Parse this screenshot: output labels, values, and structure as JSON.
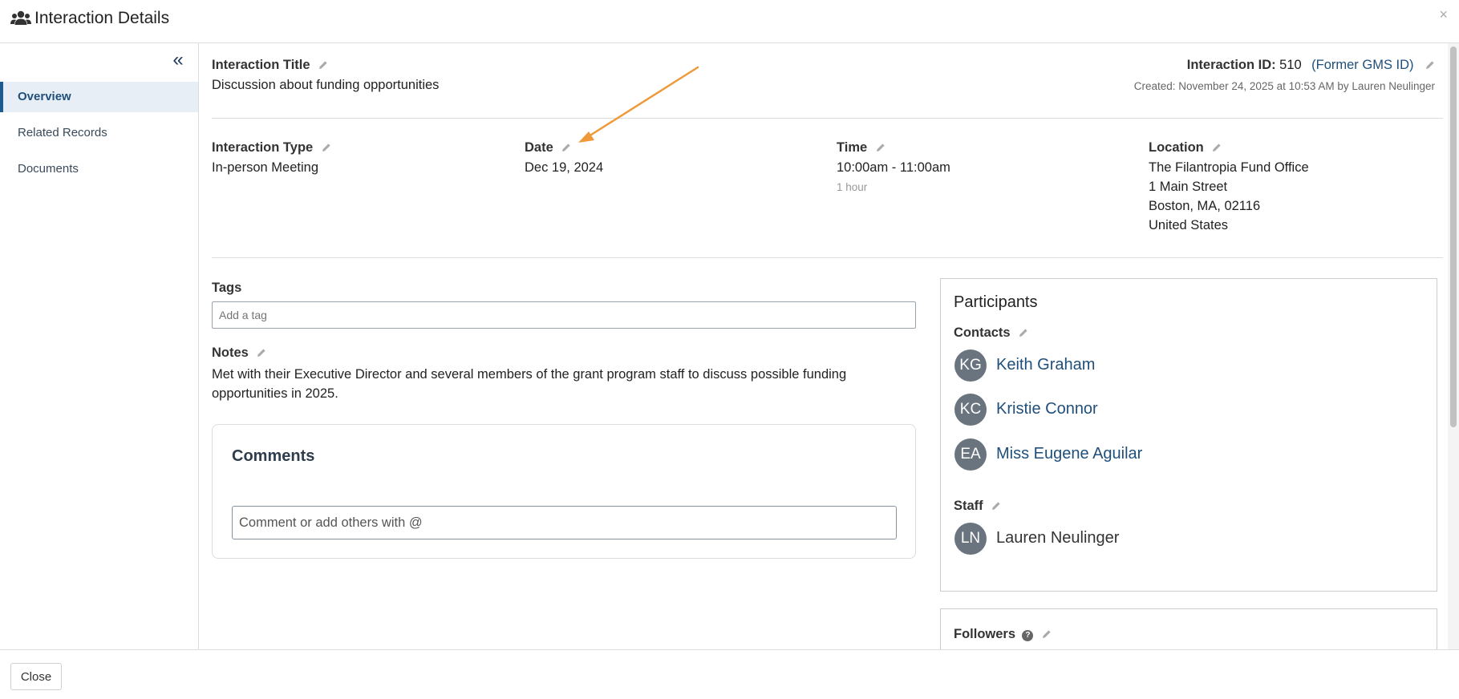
{
  "header": {
    "title": "Interaction Details",
    "icon": "users-icon",
    "close_glyph": "×"
  },
  "sidebar": {
    "collapse_glyph": "«",
    "items": [
      {
        "label": "Overview",
        "active": true
      },
      {
        "label": "Related Records",
        "active": false
      },
      {
        "label": "Documents",
        "active": false
      }
    ]
  },
  "overview": {
    "title_label": "Interaction Title",
    "title_value": "Discussion about funding opportunities",
    "id_label": "Interaction ID:",
    "id_value": "510",
    "former_id_link": "(Former GMS ID)",
    "created": "Created: November 24, 2025 at 10:53 AM by Lauren Neulinger",
    "type_label": "Interaction Type",
    "type_value": "In-person Meeting",
    "date_label": "Date",
    "date_value": "Dec 19, 2024",
    "time_label": "Time",
    "time_value": "10:00am - 11:00am",
    "duration": "1 hour",
    "location_label": "Location",
    "location_lines": [
      "The Filantropia Fund Office",
      "1 Main Street",
      "Boston, MA, 02116",
      "United States"
    ],
    "tags_label": "Tags",
    "tags_placeholder": "Add a tag",
    "notes_label": "Notes",
    "notes_value": "Met with their Executive Director and several members of the grant program staff to discuss possible funding opportunities in 2025."
  },
  "comments": {
    "title": "Comments",
    "placeholder": "Comment or add others with @"
  },
  "participants": {
    "title": "Participants",
    "contacts_label": "Contacts",
    "contacts": [
      {
        "initials": "KG",
        "name": "Keith Graham"
      },
      {
        "initials": "KC",
        "name": "Kristie Connor"
      },
      {
        "initials": "EA",
        "name": "Miss Eugene Aguilar"
      }
    ],
    "staff_label": "Staff",
    "staff": [
      {
        "initials": "LN",
        "name": "Lauren Neulinger"
      }
    ]
  },
  "followers": {
    "label": "Followers",
    "help_glyph": "?"
  },
  "footer": {
    "close_label": "Close"
  },
  "colors": {
    "accent": "#1f4f7a",
    "annotation_arrow": "#ee9a3a",
    "avatar": "#6a747e"
  }
}
